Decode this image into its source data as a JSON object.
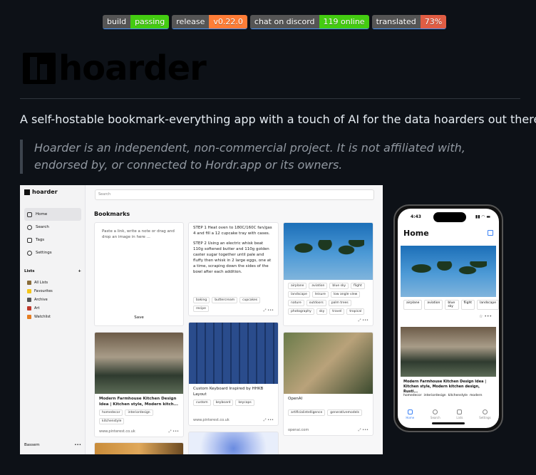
{
  "badges": [
    {
      "label": "build",
      "value": "passing",
      "color": "#4c1"
    },
    {
      "label": "release",
      "value": "v0.22.0",
      "color": "#fe7d37"
    },
    {
      "label": "chat on discord",
      "value": "119 online",
      "color": "#4c1"
    },
    {
      "label": "translated",
      "value": "73%",
      "color": "#e05d44"
    }
  ],
  "logo": {
    "text": "hoarder"
  },
  "tagline": "A self-hostable bookmark-everything app with a touch of AI for the data hoarders out there.",
  "disclaimer": "Hoarder is an independent, non-commercial project. It is not affiliated with, endorsed by, or connected to Hordr.app or its owners.",
  "desktop": {
    "app_name": "hoarder",
    "search_placeholder": "Search",
    "page_title": "Bookmarks",
    "nav": [
      {
        "label": "Home",
        "icon": "home-icon"
      },
      {
        "label": "Search",
        "icon": "search-icon"
      },
      {
        "label": "Tags",
        "icon": "tag-icon"
      },
      {
        "label": "Settings",
        "icon": "gear-icon"
      }
    ],
    "lists_heading": "Lists",
    "lists_add": "+",
    "lists": [
      {
        "label": "All Lists",
        "color": "#8a6d3b"
      },
      {
        "label": "Favourites",
        "color": "#f5c518"
      },
      {
        "label": "Archive",
        "color": "#555"
      },
      {
        "label": "Art",
        "color": "#c0392b"
      },
      {
        "label": "Watchlist",
        "color": "#e67e22"
      }
    ],
    "user": "Bassem",
    "user_menu": "•••",
    "new_note": {
      "placeholder": "Paste a link, write a note or drag and drop an image in here ...",
      "save": "Save"
    },
    "recipe": {
      "step1": "STEP 1 Heat oven to 180C/160C fan/gas 4 and fill a 12 cupcake tray with cases.",
      "step2": "STEP 2 Using an electric whisk beat 110g softened butter and 110g golden caster sugar together until pale and fluffy then whisk in 2 large eggs, one at a time, scraping down the sides of the bowl after each addition.",
      "tags": [
        "baking",
        "buttercream",
        "cupcakes",
        "recipe"
      ]
    },
    "palms": {
      "tags": [
        "airplane",
        "aviation",
        "blue sky",
        "flight",
        "landscape",
        "leisure",
        "low angle view",
        "nature",
        "outdoors",
        "palm trees",
        "photography",
        "sky",
        "travel",
        "tropical"
      ]
    },
    "kitchen": {
      "title": "Modern Farmhouse Kitchen Design Idea | Kitchen style, Modern kitch...",
      "tags": [
        "homedecor",
        "interiordesign",
        "kitchenstyle"
      ],
      "domain": "www.pinterest.co.uk"
    },
    "keyboard": {
      "title": "Custom Keyboard Inspired by HHKB Layout",
      "tags": [
        "custom",
        "keyboard",
        "keycaps"
      ],
      "domain": "www.pinterest.co.uk"
    },
    "openai": {
      "title": "OpenAI",
      "tags": [
        "artificialintelligence",
        "generativemodels"
      ],
      "domain": "openai.com"
    },
    "card_menu": "•••",
    "expand": "⤢"
  },
  "phone": {
    "time": "4:43",
    "status_icons": "▮▮ ◠ ▬",
    "title": "Home",
    "tags1": [
      "airplane",
      "aviation",
      "blue sky",
      "flight",
      "landscape"
    ],
    "caption": "Modern Farmhouse Kitchen Design Idea | Kitchen style, Modern kitchen design, Rusti...",
    "tags2": [
      "homedecor",
      "interiordesign",
      "kitchenstyle",
      "modern"
    ],
    "tabs": [
      "Home",
      "Search",
      "Lists",
      "Settings"
    ],
    "star": "☆",
    "menu": "•••"
  }
}
